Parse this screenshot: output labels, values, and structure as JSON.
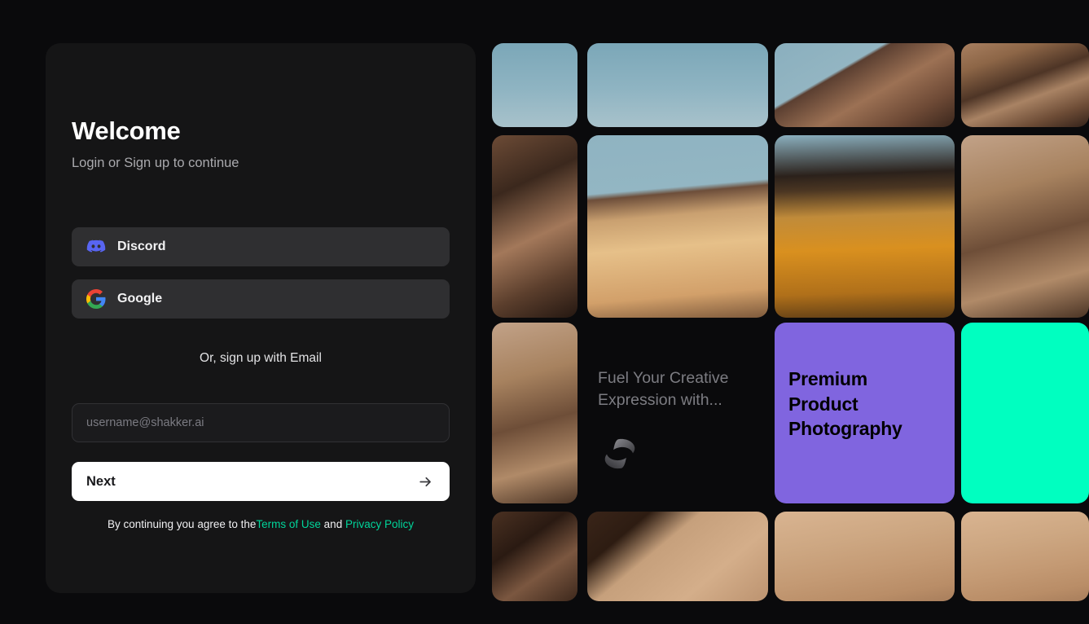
{
  "auth": {
    "title": "Welcome",
    "subtitle": "Login or Sign up to continue",
    "oauth": [
      {
        "id": "discord",
        "label": "Discord",
        "icon": "discord-icon",
        "color": "#5865F2"
      },
      {
        "id": "google",
        "label": "Google",
        "icon": "google-icon",
        "color": "#4285F4"
      }
    ],
    "divider_label": "Or, sign up with Email",
    "email": {
      "placeholder": "username@shakker.ai",
      "value": ""
    },
    "submit": {
      "label": "Next",
      "icon": "arrow-right-icon"
    },
    "legal": {
      "prefix": "By continuing you agree to the",
      "terms_link": "Terms of Use",
      "conjunction": " and ",
      "privacy_link": "Privacy Policy",
      "link_color": "#00d49a"
    }
  },
  "gallery": {
    "tagline_line1": "Fuel Your Creative",
    "tagline_line2": "Expression with...",
    "logo_icon": "shakker-logo-icon",
    "promo_card": {
      "line1": "Premium",
      "line2": "Product",
      "line3": "Photography",
      "background": "#8065df",
      "text_color": "#000000"
    },
    "accent_tile_color": "#00ffc0",
    "tiles": [
      {
        "id": "r1c1",
        "style": "sky",
        "alt": "blue sky"
      },
      {
        "id": "r1c2",
        "style": "sky",
        "alt": "blue sky"
      },
      {
        "id": "r1c3",
        "style": "sky-rock",
        "alt": "sky with rock ridge"
      },
      {
        "id": "r1c4",
        "style": "rock",
        "alt": "desert rock face"
      },
      {
        "id": "r2c1",
        "style": "rock-dark",
        "alt": "shadowed rock"
      },
      {
        "id": "r2c2",
        "style": "bottle-left",
        "alt": "amber perfume bottle left half"
      },
      {
        "id": "r2c3",
        "style": "bottle-right",
        "alt": "amber perfume bottle right half"
      },
      {
        "id": "r2c4",
        "style": "rock-light",
        "alt": "sunlit rock face"
      },
      {
        "id": "r3c1",
        "style": "rock-light",
        "alt": "sunlit rock face"
      },
      {
        "id": "r4c1",
        "style": "rock-shade",
        "alt": "dark rock in sand"
      },
      {
        "id": "r4c2",
        "style": "sand-rock",
        "alt": "rock casting shadow on sand"
      },
      {
        "id": "r4c3",
        "style": "sand",
        "alt": "sand dunes"
      },
      {
        "id": "r4c4",
        "style": "sand",
        "alt": "sand dunes"
      }
    ]
  }
}
